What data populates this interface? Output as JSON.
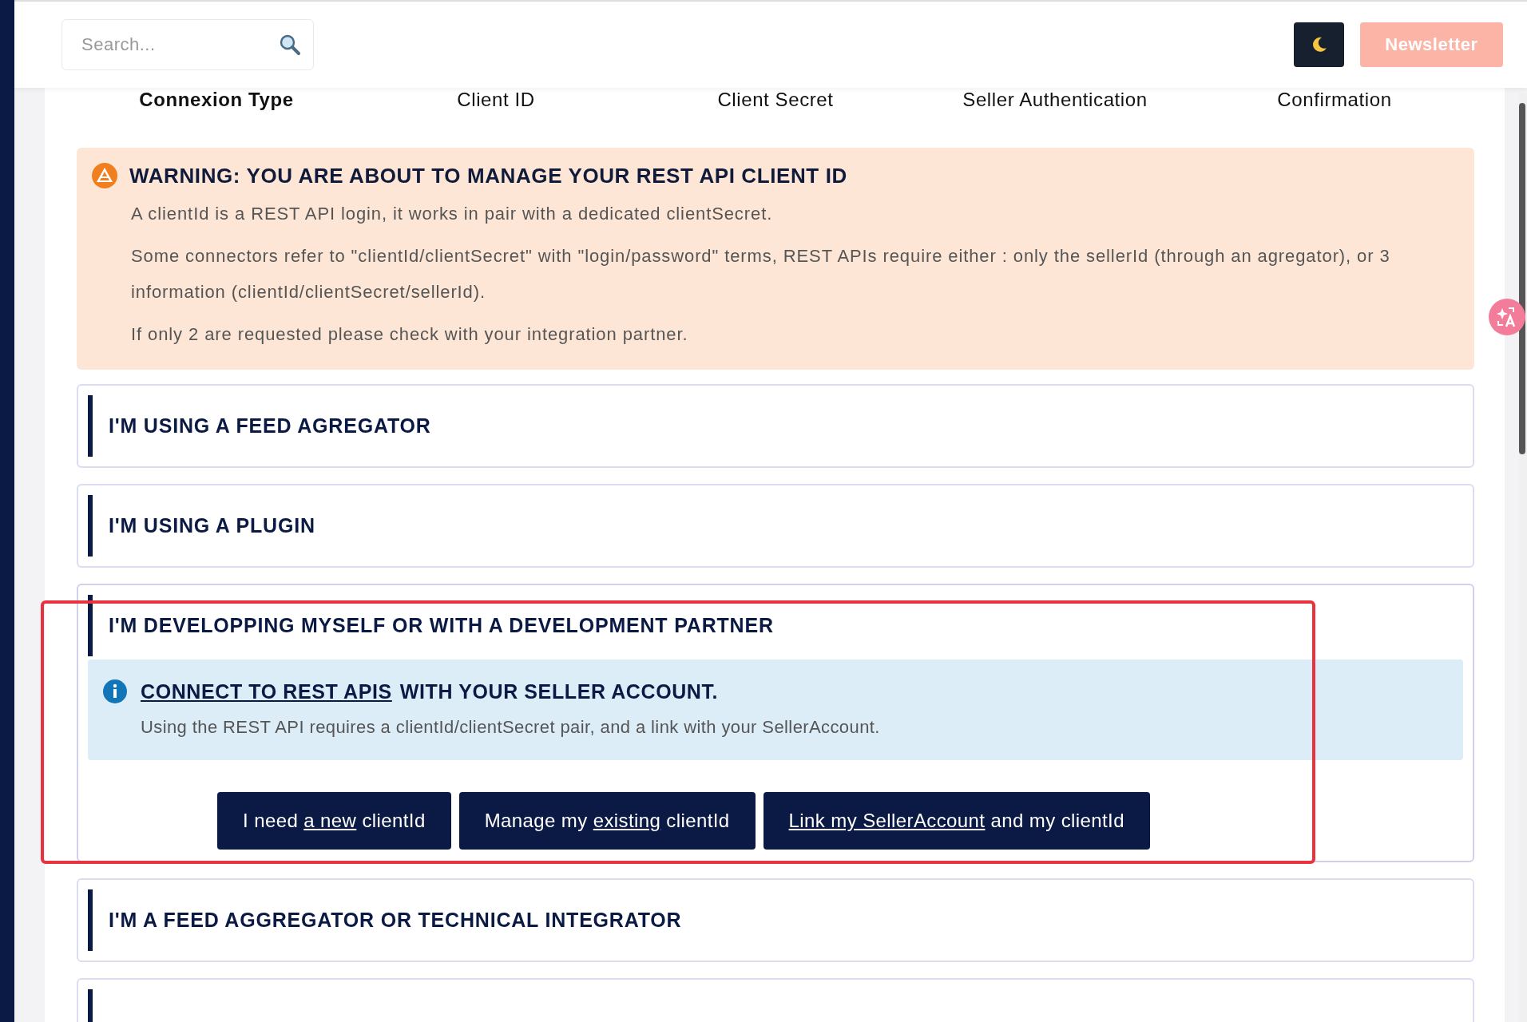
{
  "search": {
    "placeholder": "Search..."
  },
  "newsletter_button": {
    "label": "Newsletter"
  },
  "steps": [
    {
      "label": "Connexion Type",
      "selected": true
    },
    {
      "label": "Client ID",
      "selected": false
    },
    {
      "label": "Client Secret",
      "selected": false
    },
    {
      "label": "Seller Authentication",
      "selected": false
    },
    {
      "label": "Confirmation",
      "selected": false
    }
  ],
  "warning": {
    "title": "WARNING: YOU ARE ABOUT TO MANAGE YOUR REST API CLIENT ID",
    "paragraphs": [
      "A clientId is a REST API login, it works in pair with a dedicated clientSecret.",
      "Some connectors refer to \"clientId/clientSecret\" with \"login/password\" terms, REST APIs require either : only the sellerId (through an agregator), or 3 information (clientId/clientSecret/sellerId).",
      "If only 2 are requested please check with your integration partner."
    ]
  },
  "sections": [
    {
      "title": "I'M USING A FEED AGREGATOR",
      "expanded": false,
      "highlighted": false
    },
    {
      "title": "I'M USING A PLUGIN",
      "expanded": false,
      "highlighted": false
    },
    {
      "title": "I'M DEVELOPPING MYSELF OR WITH A DEVELOPMENT PARTNER",
      "expanded": true,
      "highlighted": true,
      "info": {
        "link": "CONNECT TO REST APIS",
        "title": "WITH YOUR SELLER ACCOUNT.",
        "text": "Using the REST API requires a clientId/clientSecret pair, and a link with your SellerAccount."
      },
      "buttons": [
        [
          {
            "text": "I need ",
            "underline": false
          },
          {
            "text": "a new",
            "underline": true
          },
          {
            "text": " clientId",
            "underline": false
          }
        ],
        [
          {
            "text": "Manage my ",
            "underline": false
          },
          {
            "text": "existing",
            "underline": true
          },
          {
            "text": " clientId",
            "underline": false
          }
        ],
        [
          {
            "text": "Link my SellerAccount",
            "underline": true
          },
          {
            "text": " and my clientId",
            "underline": false
          }
        ]
      ]
    },
    {
      "title": "I'M A FEED AGGREGATOR OR TECHNICAL INTEGRATOR",
      "expanded": false,
      "highlighted": false
    },
    {
      "expanded": false,
      "highlighted": false
    }
  ]
}
